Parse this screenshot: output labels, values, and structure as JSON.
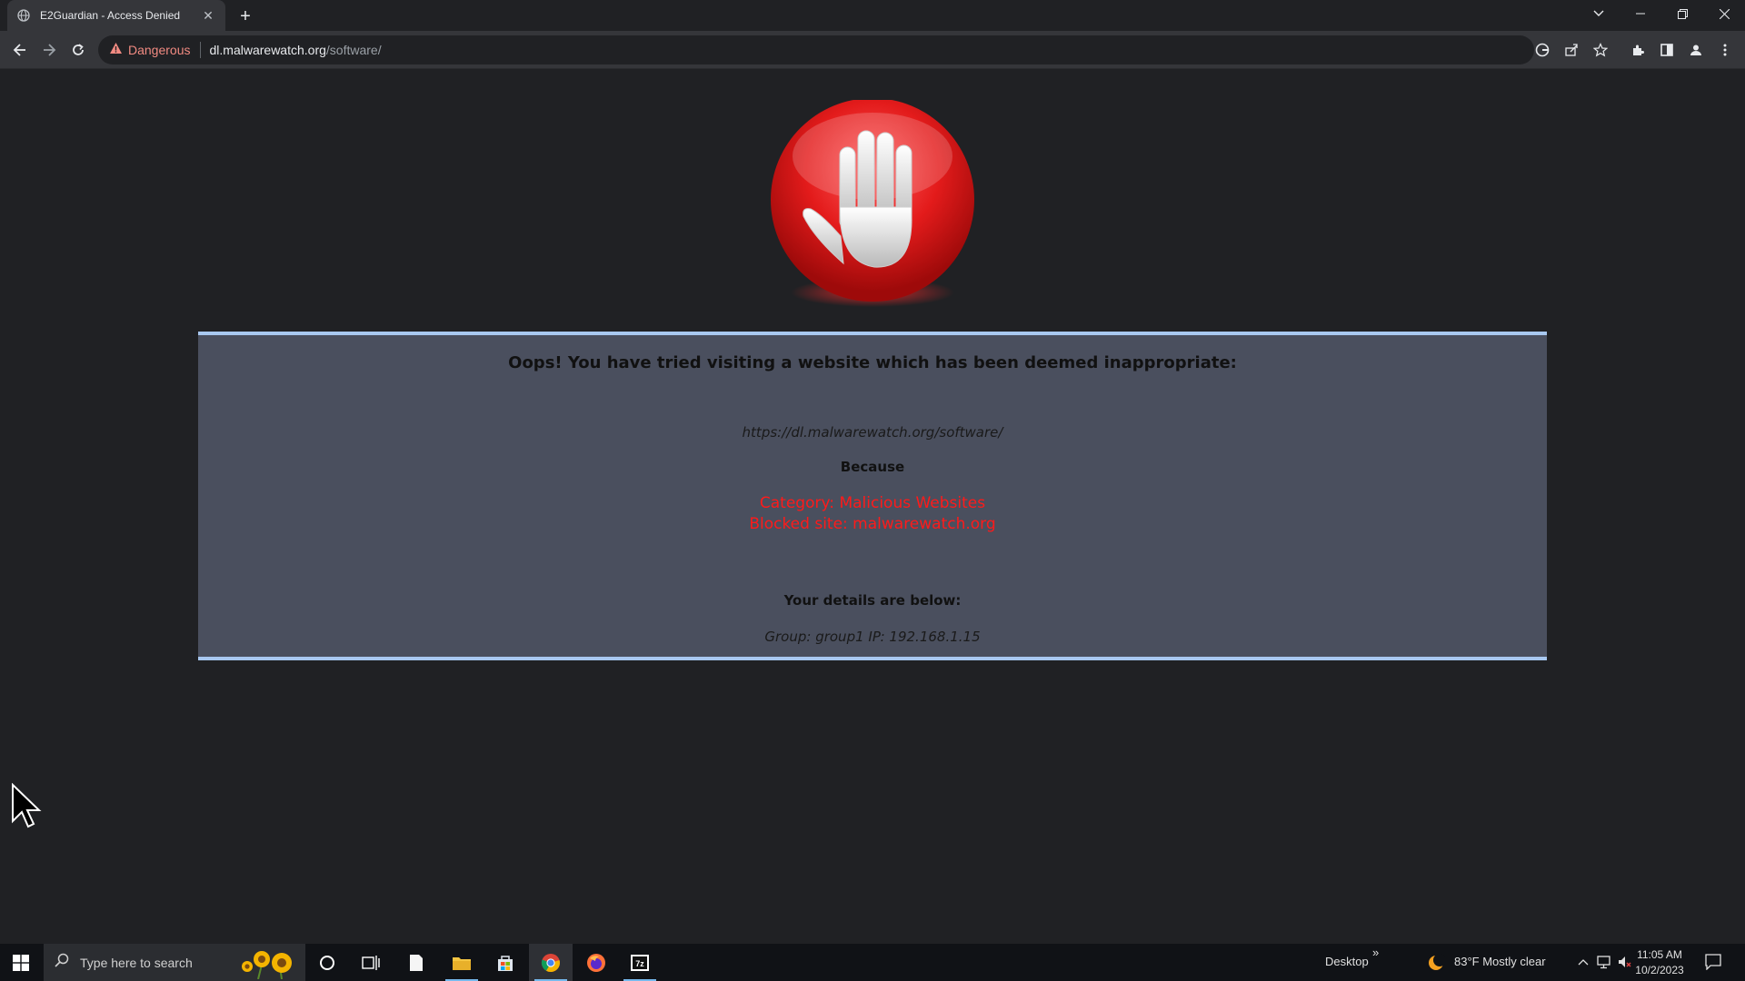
{
  "browser": {
    "tab_title": "E2Guardian - Access Denied",
    "tab_close": "✕",
    "new_tab": "+",
    "security_label": "Dangerous",
    "url_host": "dl.malwarewatch.org",
    "url_path": "/software/"
  },
  "page": {
    "heading": "Oops! You have tried visiting a website which has been deemed inappropriate:",
    "blocked_url": "https://dl.malwarewatch.org/software/",
    "because": "Because",
    "category": "Category: Malicious Websites",
    "blocked_site": "Blocked site: malwarewatch.org",
    "details_heading": "Your details are below:",
    "group_ip": "Group: group1   IP: 192.168.1.15"
  },
  "taskbar": {
    "search_placeholder": "Type here to search",
    "desktop_label": "Desktop",
    "desktop_chevron": "»",
    "weather": "83°F  Mostly clear",
    "time": "11:05 AM",
    "date": "10/2/2023"
  },
  "colors": {
    "danger": "#f28b82",
    "blocked_reason": "#ff1a1a",
    "panel_bg": "#4a4f5e",
    "panel_border": "#a8c8f0"
  }
}
